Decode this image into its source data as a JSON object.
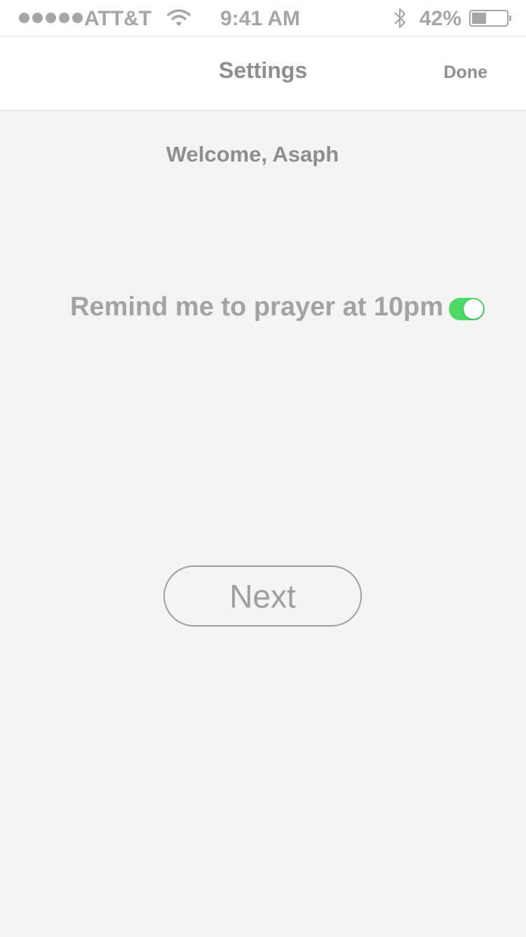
{
  "status_bar": {
    "carrier": "ATT&T",
    "time": "9:41 AM",
    "battery_percent": "42%",
    "battery_level": 0.42,
    "signal_bars": 5,
    "icons": [
      "signal-dots-icon",
      "wifi-icon",
      "bluetooth-icon",
      "battery-icon"
    ]
  },
  "nav": {
    "title": "Settings",
    "done_label": "Done"
  },
  "main": {
    "welcome": "Welcome, Asaph",
    "reminder_label": "Remind me to prayer at 10pm",
    "reminder_enabled": true,
    "toggle_on_color": "#4cd964",
    "next_label": "Next"
  }
}
